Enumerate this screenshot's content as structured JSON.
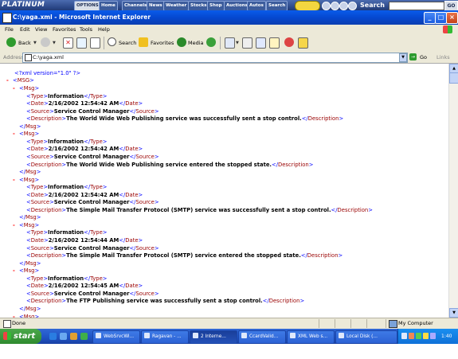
{
  "platinum": {
    "logo": "PLATINUM",
    "options_label": "OPTIONS ▸",
    "buttons": [
      "Home",
      "Channels",
      "News",
      "Weather",
      "Stocks",
      "Shop",
      "Auctions",
      "Autos",
      "Search"
    ],
    "search_label": "Search",
    "go_label": "GO"
  },
  "window": {
    "title": "C:\\yaga.xml - Microsoft Internet Explorer"
  },
  "menu": [
    "File",
    "Edit",
    "View",
    "Favorites",
    "Tools",
    "Help"
  ],
  "toolbar": {
    "back": "Back",
    "search": "Search",
    "favorites": "Favorites",
    "media": "Media"
  },
  "address": {
    "label": "Address",
    "value": "C:\\yaga.xml",
    "go": "Go",
    "links": "Links"
  },
  "xml": {
    "declaration": "<?xml version=\"1.0\" ?>",
    "root_open": "<MSG>",
    "messages": [
      {
        "type": "Information",
        "date": "2/16/2002 12:54:42 AM",
        "source": "Service Control Manager",
        "description": "The World Wide Web Publishing service was successfully sent a stop control."
      },
      {
        "type": "Information",
        "date": "2/16/2002 12:54:42 AM",
        "source": "Service Control Manager",
        "description": "The World Wide Web Publishing service entered the stopped state."
      },
      {
        "type": "Information",
        "date": "2/16/2002 12:54:42 AM",
        "source": "Service Control Manager",
        "description": "The Simple Mail Transfer Protocol (SMTP) service was successfully sent a stop control."
      },
      {
        "type": "Information",
        "date": "2/16/2002 12:54:44 AM",
        "source": "Service Control Manager",
        "description": "The Simple Mail Transfer Protocol (SMTP) service entered the stopped state."
      },
      {
        "type": "Information",
        "date": "2/16/2002 12:54:45 AM",
        "source": "Service Control Manager",
        "description": "The FTP Publishing service was successfully sent a stop control."
      }
    ]
  },
  "status": {
    "text": "Done",
    "zone": "My Computer"
  },
  "taskbar": {
    "start": "start",
    "tasks": [
      "WebSrvcWi...",
      "Ragavan - ...",
      "2 Interne...",
      "CcardValid...",
      "XML Web s...",
      "Local Disk (..."
    ],
    "clock": "1:40 AM"
  },
  "colors": {
    "xml_markup": "#0000ff",
    "xml_tag": "#990000",
    "xml_collapse": "#ff0000",
    "titlebar": "#0548d0",
    "taskbar": "#2156c7",
    "start": "#2f8a2f"
  }
}
